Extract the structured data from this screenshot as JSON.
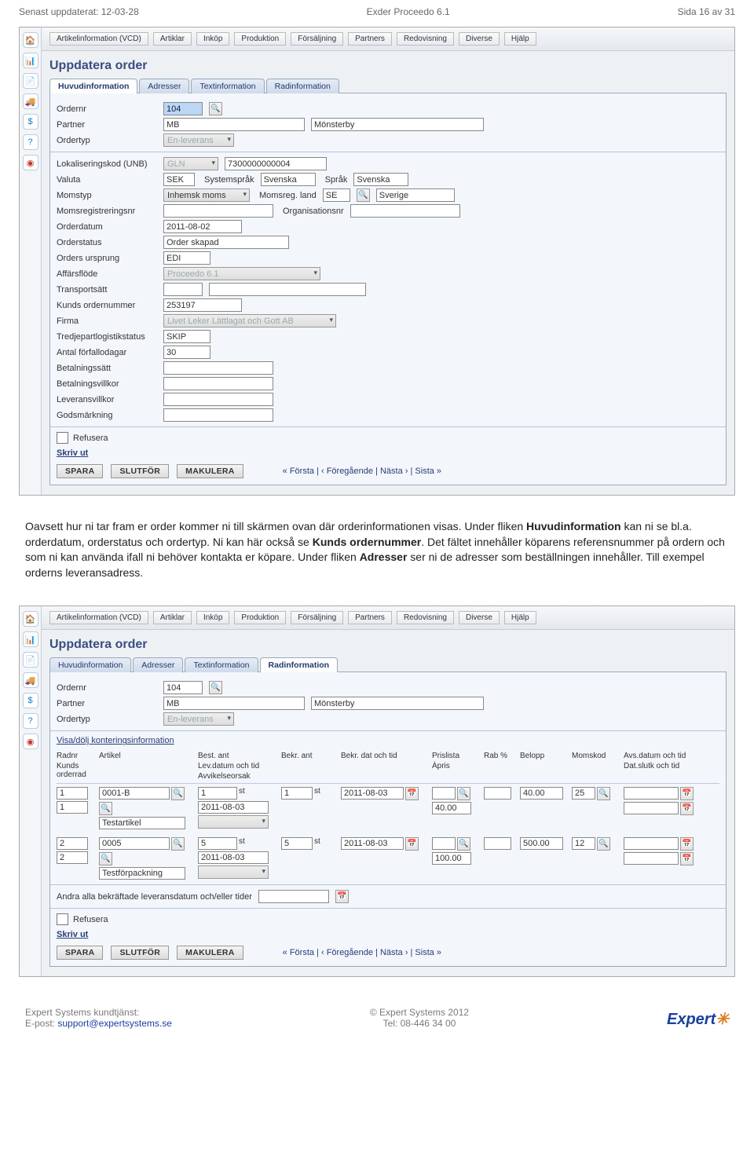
{
  "doc": {
    "updated": "Senast uppdaterat: 12-03-28",
    "product": "Exder Proceedo 6.1",
    "page": "Sida 16 av 31"
  },
  "body_text": {
    "p1a": "Oavsett hur ni tar fram er order kommer ni till skärmen ovan där orderinformationen visas. Under fliken ",
    "p1b": "Huvudinformation",
    "p1c": " kan ni se bl.a. orderdatum, orderstatus och ordertyp. Ni kan här också se ",
    "p1d": "Kunds ordernummer",
    "p1e": ". Det fältet innehåller köparens referensnummer på ordern och som ni kan använda ifall ni behöver kontakta er köpare. Under fliken ",
    "p1f": "Adresser",
    "p1g": " ser ni de adresser som beställningen innehåller. Till exempel orderns leveransadress."
  },
  "menu": [
    "Artikelinformation (VCD)",
    "Artiklar",
    "Inköp",
    "Produktion",
    "Försäljning",
    "Partners",
    "Redovisning",
    "Diverse",
    "Hjälp"
  ],
  "title": "Uppdatera order",
  "tabs": [
    "Huvudinformation",
    "Adresser",
    "Textinformation",
    "Radinformation"
  ],
  "s1": {
    "ordernr_lbl": "Ordernr",
    "ordernr": "104",
    "partner_lbl": "Partner",
    "partner": "MB",
    "partner_name": "Mönsterby",
    "ordertyp_lbl": "Ordertyp",
    "ordertyp": "En-leverans",
    "lok_lbl": "Lokaliseringskod (UNB)",
    "lok_sel": "GLN",
    "lok_val": "7300000000004",
    "valuta_lbl": "Valuta",
    "valuta": "SEK",
    "syssprak_lbl": "Systemspråk",
    "syssprak": "Svenska",
    "sprak_lbl": "Språk",
    "sprak": "Svenska",
    "momstyp_lbl": "Momstyp",
    "momstyp": "Inhemsk moms",
    "momsland_lbl": "Momsreg. land",
    "momsland": "SE",
    "momsland_name": "Sverige",
    "momsreg_lbl": "Momsregistreringsnr",
    "orgnr_lbl": "Organisationsnr",
    "orderdatum_lbl": "Orderdatum",
    "orderdatum": "2011-08-02",
    "orderstatus_lbl": "Orderstatus",
    "orderstatus": "Order skapad",
    "ursprung_lbl": "Orders ursprung",
    "ursprung": "EDI",
    "affarsflode_lbl": "Affärsflöde",
    "affarsflode": "Proceedo 6.1",
    "transport_lbl": "Transportsätt",
    "kundsnr_lbl": "Kunds ordernummer",
    "kundsnr": "253197",
    "firma_lbl": "Firma",
    "firma": "Livet Leker Lättlagat och Gott AB",
    "tpl_lbl": "Tredjepartlogistikstatus",
    "tpl": "SKIP",
    "forfallo_lbl": "Antal förfallodagar",
    "forfallo": "30",
    "betalsatt_lbl": "Betalningssätt",
    "betalvillkor_lbl": "Betalningsvillkor",
    "levvillkor_lbl": "Leveransvillkor",
    "godsmark_lbl": "Godsmärkning",
    "refusera": "Refusera",
    "skrivut": "Skriv ut"
  },
  "actions": {
    "spara": "SPARA",
    "slutfor": "SLUTFÖR",
    "makulera": "MAKULERA"
  },
  "nav": "« Första  |  ‹ Föregående  |  Nästa ›  |  Sista »",
  "s2": {
    "konteringslink": "Visa/dölj konteringsinformation",
    "hdr": {
      "radnr": "Radnr",
      "kunds": "Kunds orderrad",
      "artikel": "Artikel",
      "best": "Best. ant",
      "levdatum": "Lev.datum och tid",
      "avvik": "Avvikelseorsak",
      "bekr": "Bekr. ant",
      "bekrd": "Bekr. dat och tid",
      "prislista": "Prislista",
      "apris": "Àpris",
      "rab": "Rab %",
      "belopp": "Belopp",
      "momskod": "Momskod",
      "avs": "Avs.datum och tid",
      "datslut": "Dat.slutk och tid"
    },
    "rows": [
      {
        "radnr": "1",
        "kunds": "1",
        "artikel": "0001-B",
        "artname": "Testartikel",
        "best": "1",
        "unit": "st",
        "levdatum": "2011-08-03",
        "bekr": "1",
        "bekrunit": "st",
        "bekrd": "2011-08-03",
        "apris": "40.00",
        "belopp": "40.00",
        "momskod": "25"
      },
      {
        "radnr": "2",
        "kunds": "2",
        "artikel": "0005",
        "artname": "Testförpackning",
        "best": "5",
        "unit": "st",
        "levdatum": "2011-08-03",
        "bekr": "5",
        "bekrunit": "st",
        "bekrd": "2011-08-03",
        "apris": "100.00",
        "belopp": "500.00",
        "momskod": "12"
      }
    ],
    "andra_lbl": "Andra alla bekräftade leveransdatum och/eller tider"
  },
  "footer": {
    "l1": "Expert Systems kundtjänst:",
    "l2": "E-post: ",
    "email": "support@expertsystems.se",
    "c1": "© Expert Systems 2012",
    "c2": "Tel: 08-446 34 00",
    "brand": "Expert"
  },
  "iconnames": [
    "home-icon",
    "chart-icon",
    "doc-icon",
    "truck-icon",
    "money-icon",
    "help-icon",
    "record-icon"
  ],
  "iconglyphs": [
    "🏠",
    "📊",
    "📄",
    "🚚",
    "$",
    "?",
    "◉"
  ]
}
